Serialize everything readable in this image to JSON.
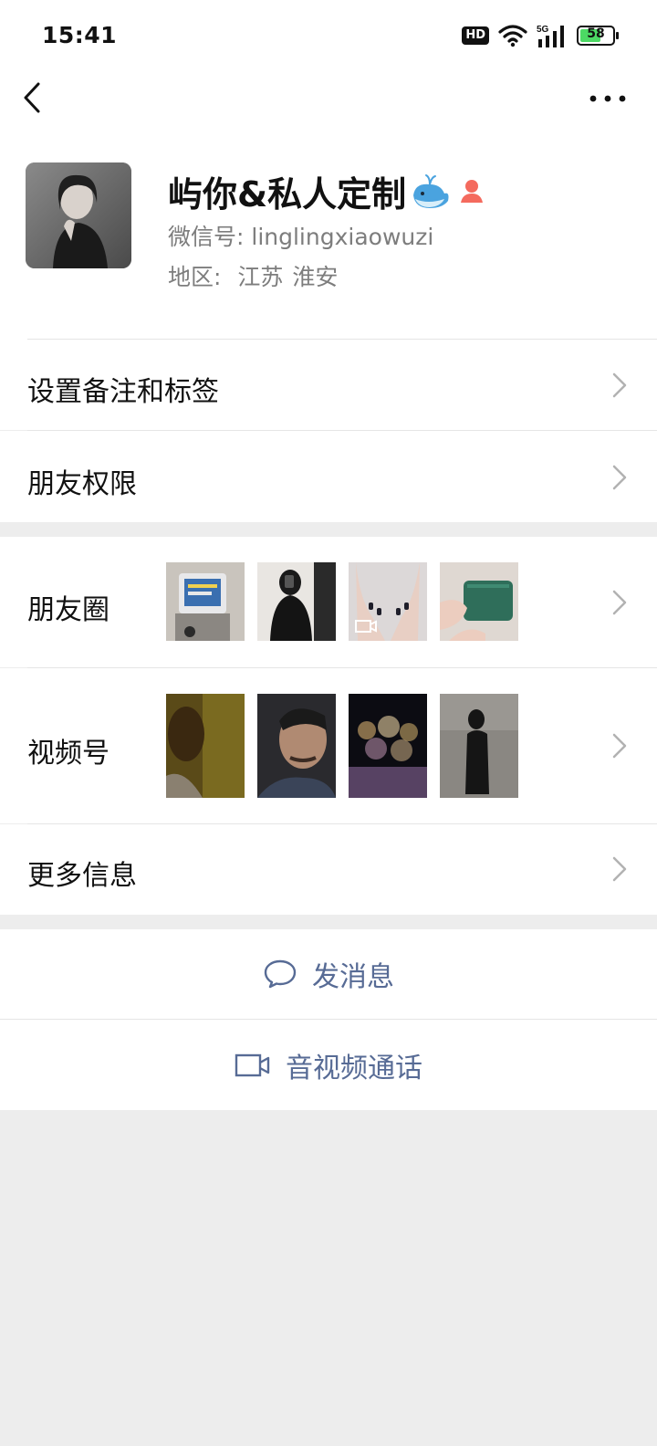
{
  "status_bar": {
    "time": "15:41",
    "network": "5G",
    "battery": "58",
    "hd": "HD",
    "icons": [
      "hd-icon",
      "wifi-icon",
      "signal-icon",
      "battery-icon"
    ]
  },
  "nav": {
    "back_icon": "back-chevron-icon",
    "more_icon": "more-dots-icon"
  },
  "profile": {
    "nickname": "屿你&私人定制",
    "nickname_emoji": "whale-icon",
    "badge_icon": "person-badge-icon",
    "wechat_id_label": "微信号: ",
    "wechat_id": "linglingxiaowuzi",
    "region_label": "地区: ",
    "region_province": "江苏",
    "region_city": "淮安"
  },
  "rows": {
    "remarks": "设置备注和标签",
    "permissions": "朋友权限",
    "moments": "朋友圈",
    "channels": "视频号",
    "more_info": "更多信息"
  },
  "actions": {
    "message": "发消息",
    "call": "音视频通话"
  },
  "colors": {
    "link_blue": "#576b95",
    "background": "#ededed",
    "divider": "#e5e5e5",
    "secondary_text": "#7d7d7d"
  }
}
